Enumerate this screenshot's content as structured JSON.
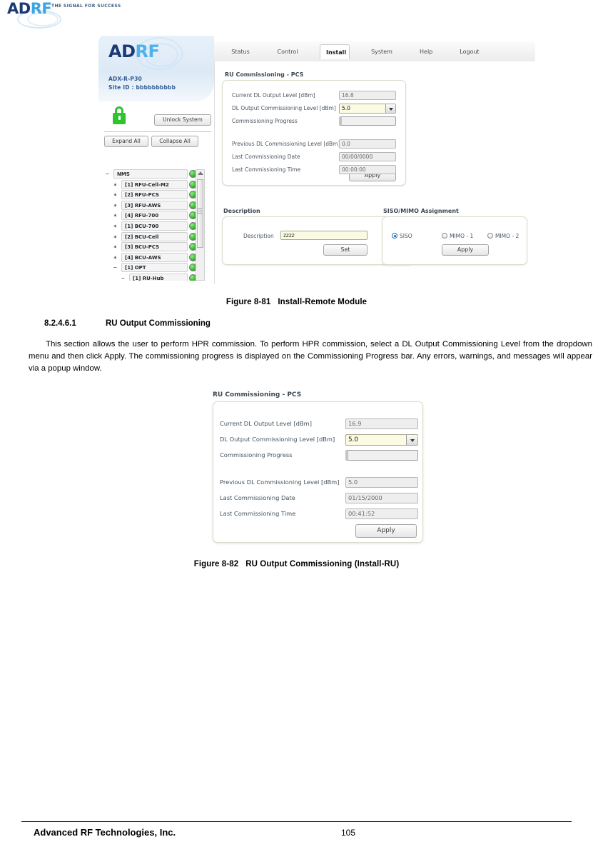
{
  "page_header": {
    "logo_main": "AD",
    "logo_accent": "RF",
    "tagline": "THE SIGNAL FOR SUCCESS"
  },
  "figure1": {
    "side_panel": {
      "logo_main": "AD",
      "logo_accent": "RF",
      "model": "ADX-R-P30",
      "site_id": "Site ID : bbbbbbbbbb",
      "unlock_button": "Unlock System",
      "expand_button": "Expand All",
      "collapse_button": "Collapse All"
    },
    "tabs": [
      {
        "label": "Status",
        "active": false
      },
      {
        "label": "Control",
        "active": false
      },
      {
        "label": "Install",
        "active": true
      },
      {
        "label": "System",
        "active": false
      },
      {
        "label": "Help",
        "active": false
      },
      {
        "label": "Logout",
        "active": false
      }
    ],
    "tree": [
      {
        "label": "NMS",
        "toggle": "−",
        "depth": 0,
        "status": "green"
      },
      {
        "label": "[1] RFU-Cell-M2",
        "toggle": "✶",
        "depth": 1,
        "status": "green"
      },
      {
        "label": "[2] RFU-PCS",
        "toggle": "✶",
        "depth": 1,
        "status": "green"
      },
      {
        "label": "[3] RFU-AWS",
        "toggle": "✶",
        "depth": 1,
        "status": "green"
      },
      {
        "label": "[4] RFU-700",
        "toggle": "✶",
        "depth": 1,
        "status": "green"
      },
      {
        "label": "[1] BCU-700",
        "toggle": "✶",
        "depth": 1,
        "status": "green"
      },
      {
        "label": "[2] BCU-Cell",
        "toggle": "✶",
        "depth": 1,
        "status": "green"
      },
      {
        "label": "[3] BCU-PCS",
        "toggle": "✶",
        "depth": 1,
        "status": "green"
      },
      {
        "label": "[4] BCU-AWS",
        "toggle": "✶",
        "depth": 1,
        "status": "green"
      },
      {
        "label": "[1] OPT",
        "toggle": "−",
        "depth": 1,
        "status": "green"
      },
      {
        "label": "[1] RU-Hub",
        "toggle": "−",
        "depth": 2,
        "status": "green"
      }
    ],
    "commissioning": {
      "title": "RU Commissioning - PCS",
      "rows": [
        {
          "label": "Current DL Output Level [dBm]",
          "value": "16.8",
          "type": "readonly"
        },
        {
          "label": "DL Output Commissioning Level [dBm]",
          "value": "5.0",
          "type": "select"
        },
        {
          "label": "Commissioning Progress",
          "value": "",
          "type": "progress"
        },
        {
          "label": "Previous DL Commissioning Level [dBm]",
          "value": "0.0",
          "type": "readonly"
        },
        {
          "label": "Last Commissioning Date",
          "value": "00/00/0000",
          "type": "readonly"
        },
        {
          "label": "Last Commissioning Time",
          "value": "00:00:00",
          "type": "readonly"
        }
      ],
      "apply_button": "Apply"
    },
    "description": {
      "title": "Description",
      "field_label": "Description",
      "value": "zzzz",
      "set_button": "Set"
    },
    "siso_mimo": {
      "title": "SISO/MIMO Assignment",
      "options": [
        {
          "label": "SISO",
          "selected": true
        },
        {
          "label": "MIMO - 1",
          "selected": false
        },
        {
          "label": "MIMO - 2",
          "selected": false
        }
      ],
      "apply_button": "Apply"
    }
  },
  "caption1": {
    "number": "Figure 8-81",
    "text": "Install-Remote Module"
  },
  "section": {
    "number": "8.2.4.6.1",
    "title": "RU Output Commissioning",
    "body": "This section allows the user to perform HPR commission. To perform HPR commission, select a DL Output Commissioning Level from the dropdown menu and then click Apply. The commissioning progress is displayed on the Commissioning Progress bar.  Any errors, warnings, and messages will appear via a popup window."
  },
  "figure2": {
    "title": "RU Commissioning - PCS",
    "rows": [
      {
        "label": "Current DL Output Level [dBm]",
        "value": "16.9",
        "type": "readonly"
      },
      {
        "label": "DL Output Commissioning Level [dBm]",
        "value": "5.0",
        "type": "select"
      },
      {
        "label": "Commissioning Progress",
        "value": "",
        "type": "progress"
      },
      {
        "label": "Previous DL Commissioning Level [dBm]",
        "value": "5.0",
        "type": "readonly"
      },
      {
        "label": "Last Commissioning Date",
        "value": "01/15/2000",
        "type": "readonly"
      },
      {
        "label": "Last Commissioning Time",
        "value": "00:41:52",
        "type": "readonly"
      }
    ],
    "apply_button": "Apply"
  },
  "caption2": {
    "number": "Figure 8-82",
    "text": "RU Output Commissioning (Install-RU)"
  },
  "footer": {
    "company": "Advanced RF Technologies, Inc.",
    "page": "105"
  },
  "colors": {
    "brand_blue": "#1b3a73",
    "accent_blue": "#4fb3e8",
    "status_green": "#3ebb33",
    "editable_field": "#fbfbe3"
  }
}
